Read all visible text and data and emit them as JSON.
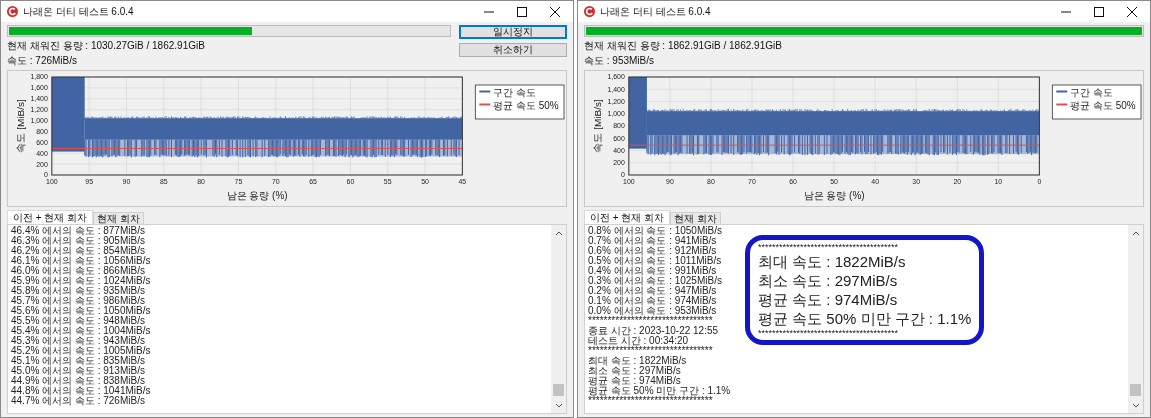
{
  "windows": [
    {
      "title": "나래온 더티 테스트 6.0.4",
      "progress": {
        "level": 0.553
      },
      "buttons": [
        {
          "label": "일시정지",
          "focused": true
        },
        {
          "label": "취소하기",
          "focused": false
        }
      ],
      "filled_capacity": "현재 채워진 용량 : 1030.27GiB / 1862.91GiB",
      "speed": "속도 : 726MiB/s",
      "chart": {
        "y_axis_label": "속도 [MiB/s]",
        "x_axis_label": "남은 용량 (%)",
        "y_tick_labels": [
          "1,800",
          "1,600",
          "1,400",
          "1,200",
          "1,000",
          "800",
          "600",
          "400",
          "200",
          "0"
        ],
        "x_tick_labels": [
          "100",
          "95",
          "90",
          "85",
          "80",
          "75",
          "70",
          "65",
          "60",
          "55",
          "50",
          "45"
        ],
        "legend": [
          {
            "label": "구간 속도",
            "color": "#4264a3"
          },
          {
            "label": "평균 속도 50%",
            "color": "#e0504e"
          }
        ]
      },
      "tabs": [
        {
          "label": "이전 + 현재 회차",
          "selected": true
        },
        {
          "label": "현재 회차",
          "selected": false
        }
      ],
      "log_lines": [
        "46.4% 에서의 속도 : 877MiB/s",
        "46.3% 에서의 속도 : 905MiB/s",
        "46.2% 에서의 속도 : 854MiB/s",
        "46.1% 에서의 속도 : 1056MiB/s",
        "46.0% 에서의 속도 : 866MiB/s",
        "45.9% 에서의 속도 : 1024MiB/s",
        "45.8% 에서의 속도 : 935MiB/s",
        "45.7% 에서의 속도 : 986MiB/s",
        "45.6% 에서의 속도 : 1050MiB/s",
        "45.5% 에서의 속도 : 948MiB/s",
        "45.4% 에서의 속도 : 1004MiB/s",
        "45.3% 에서의 속도 : 943MiB/s",
        "45.2% 에서의 속도 : 1005MiB/s",
        "45.1% 에서의 속도 : 835MiB/s",
        "45.0% 에서의 속도 : 913MiB/s",
        "44.9% 에서의 속도 : 838MiB/s",
        "44.8% 에서의 속도 : 1041MiB/s",
        "44.7% 에서의 속도 : 726MiB/s"
      ]
    },
    {
      "title": "나래온 더티 테스트 6.0.4",
      "progress": {
        "level": 1
      },
      "filled_capacity": "현재 채워진 용량 : 1862.91GiB / 1862.91GiB",
      "speed": "속도 : 953MiB/s",
      "chart": {
        "y_axis_label": "속도 [MiB/s]",
        "x_axis_label": "남은 용량 (%)",
        "y_tick_labels": [
          "1,600",
          "1,400",
          "1,200",
          "1,000",
          "800",
          "600",
          "400",
          "200",
          "0"
        ],
        "x_tick_labels": [
          "100",
          "90",
          "80",
          "70",
          "60",
          "50",
          "40",
          "30",
          "20",
          "10",
          "0"
        ],
        "legend": [
          {
            "label": "구간 속도",
            "color": "#4264a3"
          },
          {
            "label": "평균 속도 50%",
            "color": "#e0504e"
          }
        ]
      },
      "tabs": [
        {
          "label": "이전 + 현재 회차",
          "selected": true
        },
        {
          "label": "현재 회차",
          "selected": false
        }
      ],
      "log_lines": [
        "0.8% 에서의 속도 : 1050MiB/s",
        "0.7% 에서의 속도 : 941MiB/s",
        "0.6% 에서의 속도 : 912MiB/s",
        "0.5% 에서의 속도 : 1011MiB/s",
        "0.4% 에서의 속도 : 991MiB/s",
        "0.3% 에서의 속도 : 1025MiB/s",
        "0.2% 에서의 속도 : 947MiB/s",
        "0.1% 에서의 속도 : 974MiB/s",
        "0.0% 에서의 속도 : 953MiB/s",
        "********************************",
        "종료 시간 : 2023-10-22 12:55",
        "테스트 시간 : 00:34:20",
        "********************************",
        "최대 속도 : 1822MiB/s",
        "최소 속도 : 297MiB/s",
        "평균 속도 : 974MiB/s",
        "평균 속도 50% 미만 구간 : 1.1%",
        "********************************"
      ],
      "callout": {
        "lines": [
          "****************************************",
          "최대 속도 : 1822MiB/s",
          "최소 속도 : 297MiB/s",
          "평균 속도 : 974MiB/s",
          "평균 속도 50% 미만 구간 : 1.1%",
          "****************************************"
        ]
      }
    }
  ]
}
